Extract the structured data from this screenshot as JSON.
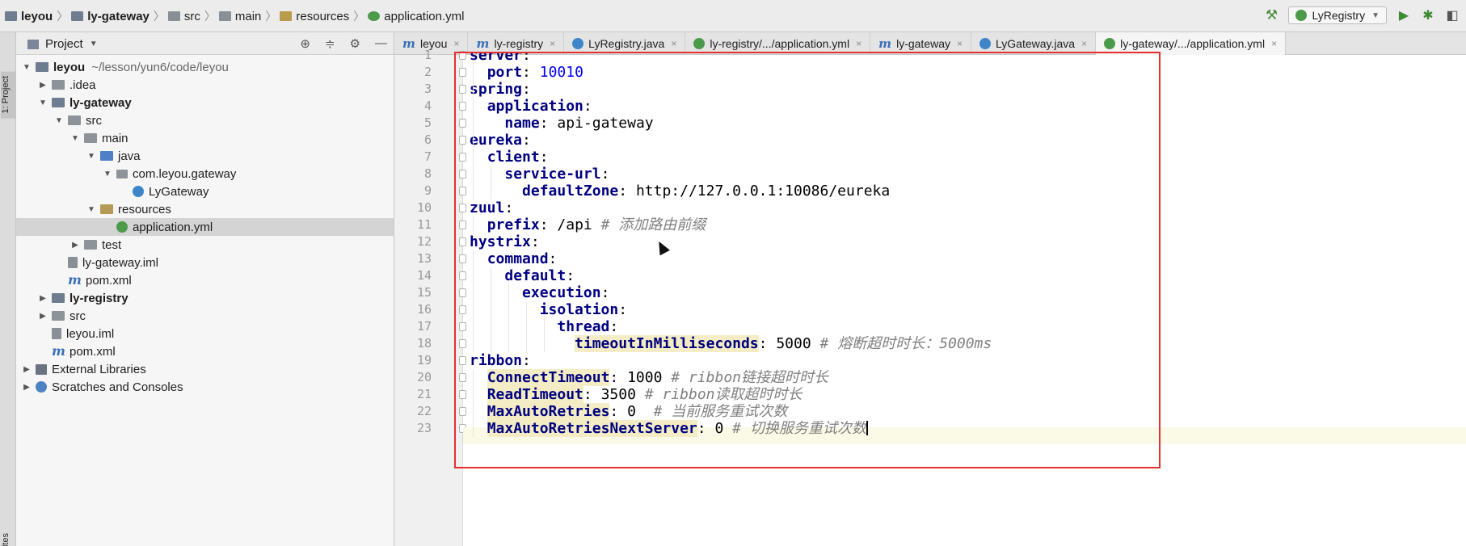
{
  "breadcrumbs": [
    {
      "label": "leyou",
      "icon": "module-icon",
      "bold": true
    },
    {
      "label": "ly-gateway",
      "icon": "module-icon",
      "bold": true
    },
    {
      "label": "src",
      "icon": "folder-icon",
      "bold": false
    },
    {
      "label": "main",
      "icon": "folder-icon",
      "bold": false
    },
    {
      "label": "resources",
      "icon": "resources-folder-icon",
      "bold": false
    },
    {
      "label": "application.yml",
      "icon": "yaml-file-icon",
      "bold": false
    }
  ],
  "toolbar": {
    "run_config": "LyRegistry",
    "icons": [
      "build-hammer-icon",
      "run-icon",
      "debug-icon",
      "coverage-icon"
    ]
  },
  "tool_strip": {
    "project_label": "1: Project",
    "favorites_label": "avorites"
  },
  "project_panel": {
    "title": "Project",
    "tools": [
      "locate-icon",
      "collapse-icon",
      "settings-icon",
      "hide-icon"
    ],
    "tree": [
      {
        "label": "leyou",
        "path": "~/lesson/yun6/code/leyou",
        "bold": true,
        "arrow": "▼",
        "icon": "folder-mod",
        "indent": 0
      },
      {
        "label": ".idea",
        "arrow": "▶",
        "icon": "folder",
        "indent": 1
      },
      {
        "label": "ly-gateway",
        "bold": true,
        "arrow": "▼",
        "icon": "folder-mod",
        "indent": 1
      },
      {
        "label": "src",
        "arrow": "▼",
        "icon": "folder",
        "indent": 2
      },
      {
        "label": "main",
        "arrow": "▼",
        "icon": "folder",
        "indent": 3
      },
      {
        "label": "java",
        "arrow": "▼",
        "icon": "folder-blue",
        "indent": 4
      },
      {
        "label": "com.leyou.gateway",
        "arrow": "▼",
        "icon": "pkg",
        "indent": 5
      },
      {
        "label": "LyGateway",
        "arrow": "",
        "icon": "java",
        "indent": 6
      },
      {
        "label": "resources",
        "arrow": "▼",
        "icon": "folder-res",
        "indent": 4
      },
      {
        "label": "application.yml",
        "arrow": "",
        "icon": "yml",
        "indent": 5,
        "selected": true
      },
      {
        "label": "test",
        "arrow": "▶",
        "icon": "folder",
        "indent": 3
      },
      {
        "label": "ly-gateway.iml",
        "arrow": "",
        "icon": "iml",
        "indent": 2
      },
      {
        "label": "pom.xml",
        "arrow": "",
        "icon": "pom",
        "indent": 2
      },
      {
        "label": "ly-registry",
        "bold": true,
        "arrow": "▶",
        "icon": "folder-mod",
        "indent": 1
      },
      {
        "label": "src",
        "arrow": "▶",
        "icon": "folder",
        "indent": 1
      },
      {
        "label": "leyou.iml",
        "arrow": "",
        "icon": "iml",
        "indent": 1
      },
      {
        "label": "pom.xml",
        "arrow": "",
        "icon": "pom",
        "indent": 1
      },
      {
        "label": "External Libraries",
        "arrow": "▶",
        "icon": "lib",
        "indent": 0
      },
      {
        "label": "Scratches and Consoles",
        "arrow": "▶",
        "icon": "scr",
        "indent": 0
      }
    ]
  },
  "tabs": [
    {
      "label": "leyou",
      "icon": "m"
    },
    {
      "label": "ly-registry",
      "icon": "m"
    },
    {
      "label": "LyRegistry.java",
      "icon": "c"
    },
    {
      "label": "ly-registry/.../application.yml",
      "icon": "y"
    },
    {
      "label": "ly-gateway",
      "icon": "m"
    },
    {
      "label": "LyGateway.java",
      "icon": "c"
    },
    {
      "label": "ly-gateway/.../application.yml",
      "icon": "y",
      "active": true
    }
  ],
  "editor": {
    "current_line": 23,
    "lines": [
      {
        "n": "1",
        "indent": 0,
        "key": "server",
        "sep": ":",
        "val": "",
        "valType": "",
        "comment": ""
      },
      {
        "n": "2",
        "indent": 1,
        "key": "port",
        "sep": ": ",
        "val": "10010",
        "valType": "num",
        "comment": ""
      },
      {
        "n": "3",
        "indent": 0,
        "key": "spring",
        "sep": ":",
        "val": "",
        "valType": "",
        "comment": ""
      },
      {
        "n": "4",
        "indent": 1,
        "key": "application",
        "sep": ":",
        "val": "",
        "valType": "",
        "comment": ""
      },
      {
        "n": "5",
        "indent": 2,
        "key": "name",
        "sep": ": ",
        "val": "api-gateway",
        "valType": "str",
        "comment": ""
      },
      {
        "n": "6",
        "indent": 0,
        "key": "eureka",
        "sep": ":",
        "val": "",
        "valType": "",
        "comment": ""
      },
      {
        "n": "7",
        "indent": 1,
        "key": "client",
        "sep": ":",
        "val": "",
        "valType": "",
        "comment": ""
      },
      {
        "n": "8",
        "indent": 2,
        "key": "service-url",
        "sep": ":",
        "val": "",
        "valType": "",
        "comment": ""
      },
      {
        "n": "9",
        "indent": 3,
        "key": "defaultZone",
        "sep": ": ",
        "val": "http://127.0.0.1:10086/eureka",
        "valType": "str",
        "comment": ""
      },
      {
        "n": "10",
        "indent": 0,
        "key": "zuul",
        "sep": ":",
        "val": "",
        "valType": "",
        "comment": ""
      },
      {
        "n": "11",
        "indent": 1,
        "key": "prefix",
        "sep": ": ",
        "val": "/api",
        "valType": "str",
        "comment": "# 添加路由前缀"
      },
      {
        "n": "12",
        "indent": 0,
        "key": "hystrix",
        "sep": ":",
        "val": "",
        "valType": "",
        "comment": ""
      },
      {
        "n": "13",
        "indent": 1,
        "key": "command",
        "sep": ":",
        "val": "",
        "valType": "",
        "comment": ""
      },
      {
        "n": "14",
        "indent": 2,
        "key": "default",
        "sep": ":",
        "val": "",
        "valType": "",
        "comment": ""
      },
      {
        "n": "15",
        "indent": 3,
        "key": "execution",
        "sep": ":",
        "val": "",
        "valType": "",
        "comment": ""
      },
      {
        "n": "16",
        "indent": 4,
        "key": "isolation",
        "sep": ":",
        "val": "",
        "valType": "",
        "comment": ""
      },
      {
        "n": "17",
        "indent": 5,
        "key": "thread",
        "sep": ":",
        "val": "",
        "valType": "",
        "comment": ""
      },
      {
        "n": "18",
        "indent": 6,
        "key": "timeoutInMilliseconds",
        "hl": true,
        "sep": ": ",
        "val": "5000",
        "valType": "plain",
        "comment": "# 熔断超时时长：5000ms"
      },
      {
        "n": "19",
        "indent": 0,
        "key": "ribbon",
        "sep": ":",
        "val": "",
        "valType": "",
        "comment": ""
      },
      {
        "n": "20",
        "indent": 1,
        "key": "ConnectTimeout",
        "hl": true,
        "sep": ": ",
        "val": "1000",
        "valType": "plain",
        "comment": "# ribbon链接超时时长"
      },
      {
        "n": "21",
        "indent": 1,
        "key": "ReadTimeout",
        "hl": true,
        "sep": ": ",
        "val": "3500",
        "valType": "plain",
        "comment": "# ribbon读取超时时长"
      },
      {
        "n": "22",
        "indent": 1,
        "key": "MaxAutoRetries",
        "hl": true,
        "sep": ": ",
        "val": "0",
        "valType": "plain",
        "comment": " # 当前服务重试次数"
      },
      {
        "n": "23",
        "indent": 1,
        "key": "MaxAutoRetriesNextServer",
        "hl": true,
        "sep": ": ",
        "val": "0",
        "valType": "plain",
        "comment": "# 切换服务重试次数",
        "caret": true
      }
    ]
  },
  "colors": {
    "annotation_box": "#e52f2f",
    "yaml_key": "#000080",
    "yaml_number": "#0000ff",
    "comment": "#808080"
  }
}
